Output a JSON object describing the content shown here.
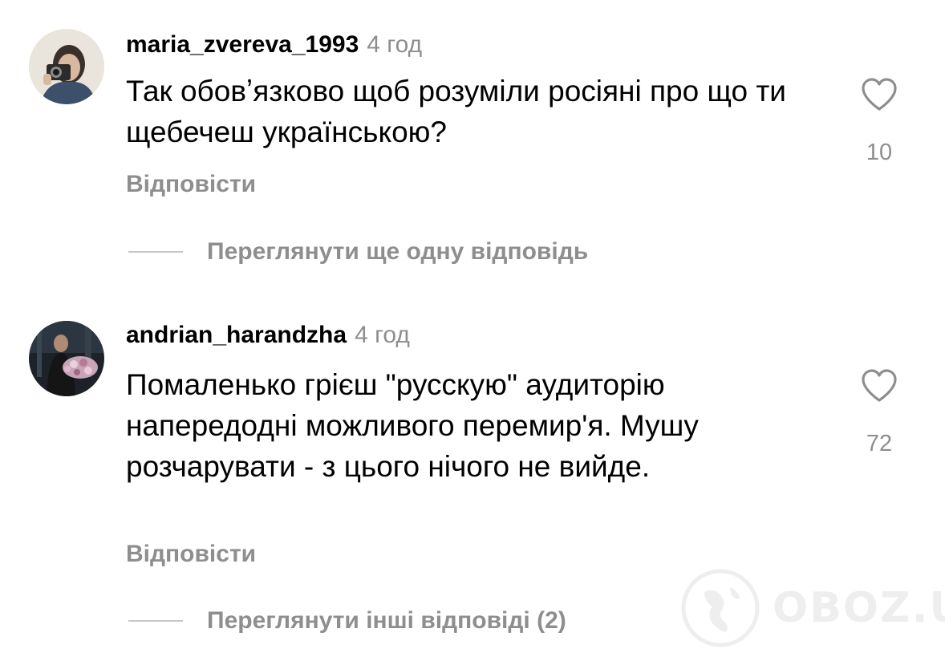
{
  "comments": [
    {
      "username": "maria_zvereva_1993",
      "time": "4 год",
      "text": "Так обовʼязково щоб розуміли росіяні про що ти щебечеш українською?",
      "likes": "10",
      "reply_label": "Відповісти",
      "view_replies_label": "Переглянути ще одну відповідь"
    },
    {
      "username": "andrian_harandzha",
      "time": "4 год",
      "text": "Помаленько грієш \"русскую\" аудиторію напередодні можливого перемир'я. Мушу розчарувати - з цього нічого не вийде.",
      "likes": "72",
      "reply_label": "Відповісти",
      "view_replies_label": "Переглянути інші відповіді (2)"
    }
  ],
  "watermark": {
    "text": "OBOZ.UA"
  },
  "colors": {
    "secondary_text": "#8e8e8e",
    "divider": "#c7c7c7",
    "primary_text": "#000000",
    "background": "#ffffff"
  },
  "icons": {
    "like": "heart-outline-icon",
    "watermark_logo": "globe-logo-icon"
  }
}
